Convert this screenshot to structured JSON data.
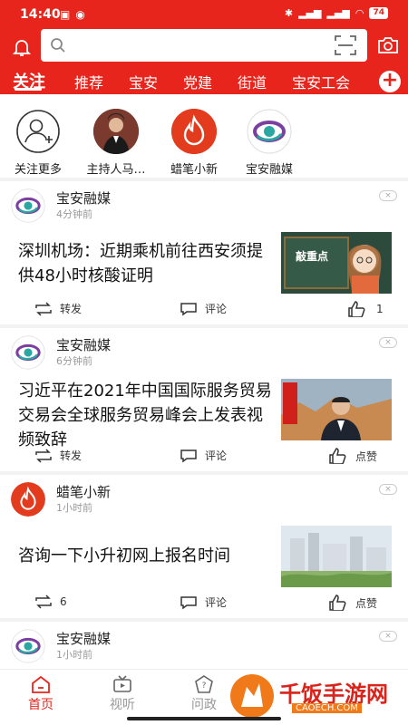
{
  "status_bar": {
    "time": "14:40",
    "battery": "74"
  },
  "search": {
    "placeholder": ""
  },
  "tabs": [
    "关注",
    "推荐",
    "宝安",
    "党建",
    "街道",
    "宝安工会"
  ],
  "follows": [
    {
      "label": "关注更多",
      "icon": "add-user-icon"
    },
    {
      "label": "主持人马…",
      "icon": "host-photo"
    },
    {
      "label": "蜡笔小新",
      "icon": "flame-logo"
    },
    {
      "label": "宝安融媒",
      "icon": "baoan-logo"
    }
  ],
  "feed": [
    {
      "source": "宝安融媒",
      "time": "4分钟前",
      "title": "深圳机场：近期乘机前往西安须提供48小时核酸证明",
      "thumb": "敲重点",
      "share": "转发",
      "comment": "评论",
      "like": "1"
    },
    {
      "source": "宝安融媒",
      "time": "6分钟前",
      "title": "习近平在2021年中国国际服务贸易交易会全球服务贸易峰会上发表视频致辞",
      "share": "转发",
      "comment": "评论",
      "like": "点赞"
    },
    {
      "source": "蜡笔小新",
      "time": "1小时前",
      "title": "咨询一下小升初网上报名时间",
      "share": "6",
      "comment": "评论",
      "like": "点赞"
    },
    {
      "source": "宝安融媒",
      "time": "1小时前"
    }
  ],
  "bottom_nav": [
    "首页",
    "视听",
    "问政"
  ],
  "watermark": {
    "text": "千饭手游网",
    "url": "CAOECH.COM"
  },
  "colors": {
    "accent": "#e8251d"
  }
}
